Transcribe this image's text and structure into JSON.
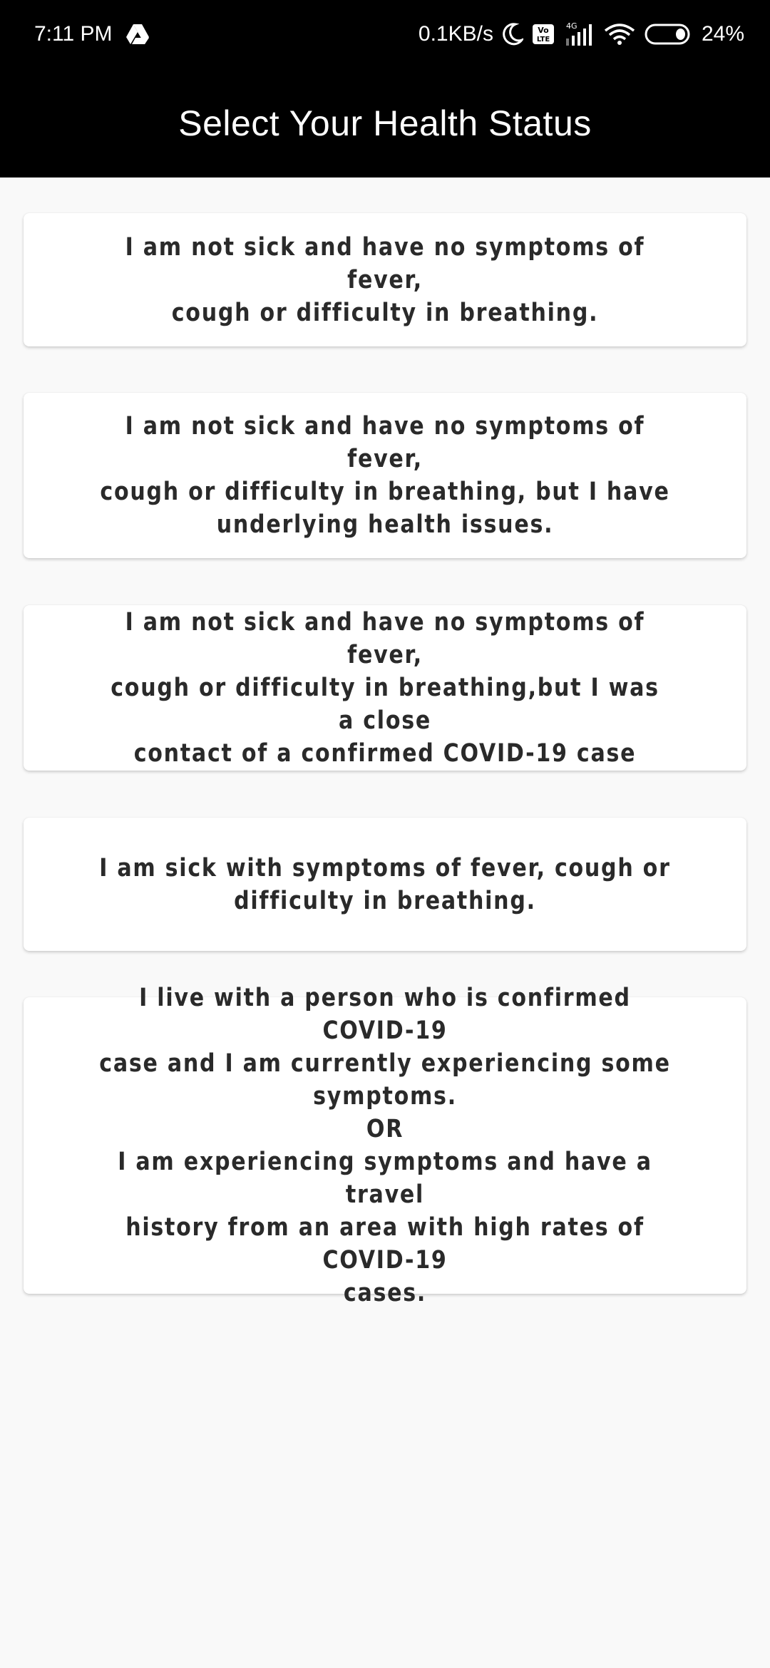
{
  "status_bar": {
    "time": "7:11 PM",
    "network_speed": "0.1KB/s",
    "network_type": "4G",
    "battery_percent": "24%",
    "icons": [
      "drive-icon",
      "moon-icon",
      "volte-icon",
      "signal-icon",
      "wifi-icon",
      "battery-icon"
    ]
  },
  "app_bar": {
    "title": "Select Your Health Status",
    "background": "#000000"
  },
  "options": [
    {
      "text": "I am not sick and have no symptoms of fever,\ncough or difficulty in breathing."
    },
    {
      "text": "I am not sick and have no symptoms of fever,\ncough or difficulty in breathing, but I have\nunderlying health issues."
    },
    {
      "text": "I am not sick and have no symptoms of fever,\ncough or difficulty in breathing,but I was a close\ncontact of a confirmed COVID-19 case"
    },
    {
      "text": "I am sick with symptoms of fever, cough or\ndifficulty in breathing."
    },
    {
      "text": "I live with a person who is confirmed COVID-19\ncase and I am currently experiencing some\nsymptoms.\nOR\nI am experiencing symptoms and have a travel\nhistory from an area with high rates of COVID-19\ncases."
    }
  ]
}
